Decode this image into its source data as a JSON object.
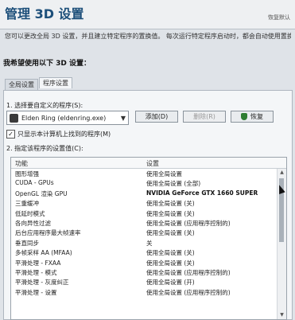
{
  "window": {
    "title": "管理 3D 设置",
    "restore_link": "恢复默认"
  },
  "description": "您可以更改全局 3D 设置，并且建立特定程序的置换值。 每次运行特定程序启动时，都会自动使用置换值。",
  "heading": "我希望使用以下 3D 设置：",
  "tabs": [
    {
      "label": "全局设置",
      "active": false
    },
    {
      "label": "程序设置",
      "active": true
    }
  ],
  "program": {
    "step_label": "1. 选择要自定义的程序(S):",
    "selected": "Elden Ring (eldenring.exe)",
    "icon": "game-icon",
    "add_label": "添加(D)",
    "delete_label": "删除(R)",
    "restore_label": "恢复"
  },
  "show_only_found": {
    "label": "只显示本计算机上找到的程序(M)",
    "checked": true,
    "mark": "✓"
  },
  "settings": {
    "step_label": "2. 指定该程序的设置值(C):",
    "columns": [
      "功能",
      "设置"
    ],
    "rows": [
      {
        "feature": "图形增强",
        "value": "使用全局设置"
      },
      {
        "feature": "CUDA - GPUs",
        "value": "使用全局设置 (全部)"
      },
      {
        "feature": "OpenGL 渲染 GPU",
        "value": "NVIDIA GeForce GTX 1660 SUPER"
      },
      {
        "feature": "三重缓冲",
        "value": "使用全局设置 (关)"
      },
      {
        "feature": "低延时模式",
        "value": "使用全局设置 (关)"
      },
      {
        "feature": "各向异性过滤",
        "value": "使用全局设置 (应用程序控制的)"
      },
      {
        "feature": "后台应用程序最大帧速率",
        "value": "使用全局设置 (关)"
      },
      {
        "feature": "垂直同步",
        "value": "关"
      },
      {
        "feature": "多帧采样 AA (MFAA)",
        "value": "使用全局设置 (关)"
      },
      {
        "feature": "平滑处理 - FXAA",
        "value": "使用全局设置 (关)"
      },
      {
        "feature": "平滑处理 - 模式",
        "value": "使用全局设置 (应用程序控制的)"
      },
      {
        "feature": "平滑处理 - 灰度纠正",
        "value": "使用全局设置 (开)"
      },
      {
        "feature": "平滑处理 - 设置",
        "value": "使用全局设置 (应用程序控制的)"
      }
    ]
  },
  "colors": {
    "title": "#1d4f7a",
    "restore_shield": "#2e7d32"
  }
}
